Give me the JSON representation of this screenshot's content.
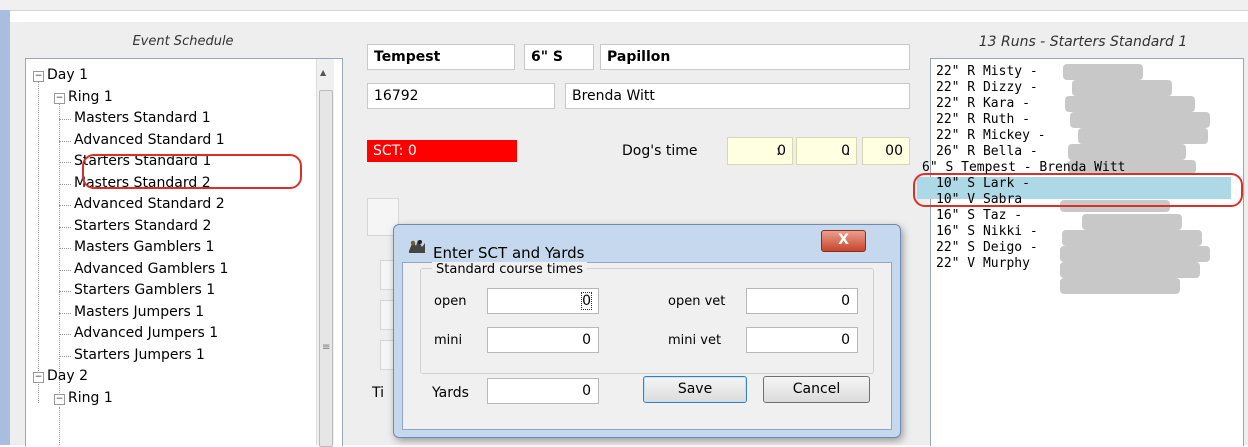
{
  "event_schedule": {
    "title": "Event Schedule",
    "tree": [
      {
        "label": "Day 1",
        "level": 0,
        "expander": "−"
      },
      {
        "label": "Ring 1",
        "level": 1,
        "expander": "−"
      },
      {
        "label": "Masters Standard 1",
        "level": 2
      },
      {
        "label": "Advanced Standard 1",
        "level": 2
      },
      {
        "label": "Starters Standard 1",
        "level": 2
      },
      {
        "label": "Masters Standard 2",
        "level": 2
      },
      {
        "label": "Advanced Standard 2",
        "level": 2
      },
      {
        "label": "Starters Standard 2",
        "level": 2
      },
      {
        "label": "Masters Gamblers 1",
        "level": 2
      },
      {
        "label": "Advanced Gamblers 1",
        "level": 2
      },
      {
        "label": "Starters Gamblers 1",
        "level": 2
      },
      {
        "label": "Masters Jumpers 1",
        "level": 2
      },
      {
        "label": "Advanced Jumpers 1",
        "level": 2
      },
      {
        "label": "Starters Jumpers 1",
        "level": 2
      },
      {
        "label": "Day 2",
        "level": 0,
        "expander": "−"
      },
      {
        "label": "Ring 1",
        "level": 1,
        "expander": "−"
      }
    ]
  },
  "dog_info": {
    "name": "Tempest",
    "height_class": "6\" S",
    "breed": "Papillon",
    "reg_number": "16792",
    "handler": "Brenda Witt",
    "sct_label": "SCT:  0",
    "dogs_time_label": "Dog's time",
    "time_min": "0",
    "time_sec": "0",
    "time_hund": "00",
    "sep1": ":",
    "sep2": ".",
    "partial_label": "Ti"
  },
  "runs": {
    "title": "13 Runs - Starters Standard 1",
    "items": [
      "22\" R  Misty  -",
      "22\" R  Dizzy  -",
      "22\" R  Kara  -",
      "22\" R  Ruth  -",
      "22\" R  Mickey  -",
      "26\" R  Bella  -",
      "6\" S  Tempest  -  Brenda Witt",
      "10\" S  Lark  -",
      "10\" V  Sabra",
      "16\" S  Taz  -",
      "16\" S  Nikki  -",
      "22\" S  Deigo  -",
      "22\" V  Murphy"
    ]
  },
  "dialog": {
    "title": "Enter SCT and Yards",
    "close_glyph": "X",
    "group_label": "Standard course times",
    "open_label": "open",
    "open_value": "0",
    "open_vet_label": "open vet",
    "open_vet_value": "0",
    "mini_label": "mini",
    "mini_value": "0",
    "mini_vet_label": "mini vet",
    "mini_vet_value": "0",
    "yards_label": "Yards",
    "yards_value": "0",
    "save_label": "Save",
    "cancel_label": "Cancel"
  },
  "colors": {
    "sct_bg": "#ff0000",
    "selected_row": "#add8e6",
    "annotation": "#d9302a"
  }
}
